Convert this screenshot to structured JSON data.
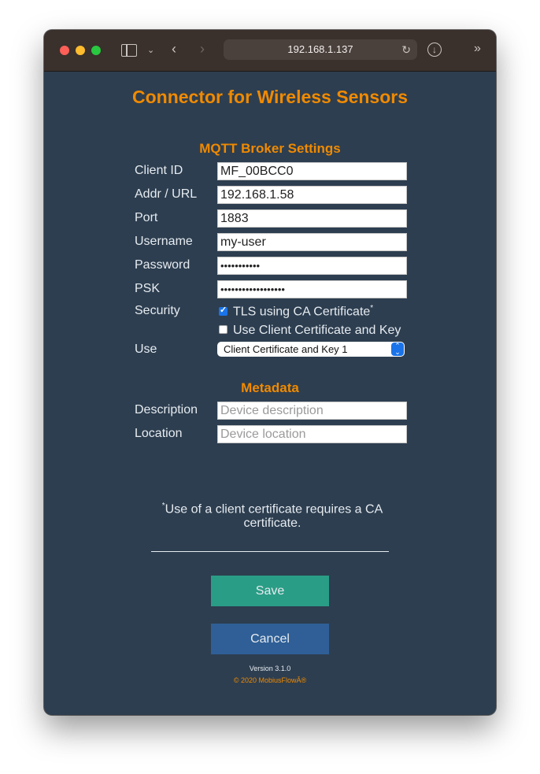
{
  "browser": {
    "url": "192.168.1.137",
    "icons": [
      "sidebar-icon",
      "chevron-down-icon",
      "back-icon",
      "forward-icon",
      "reload-icon",
      "download-icon",
      "overflow-icon"
    ]
  },
  "page": {
    "title": "Connector for Wireless Sensors",
    "mqtt": {
      "heading": "MQTT Broker Settings",
      "client_id_label": "Client ID",
      "client_id_value": "MF_00BCC0",
      "addr_label": "Addr / URL",
      "addr_value": "192.168.1.58",
      "port_label": "Port",
      "port_value": "1883",
      "username_label": "Username",
      "username_value": "my-user",
      "password_label": "Password",
      "password_value": "•••••••••••",
      "psk_label": "PSK",
      "psk_value": "••••••••••••••••••",
      "security_label": "Security",
      "tls_label": "TLS using CA Certificate",
      "tls_checked": true,
      "client_cert_label": "Use Client Certificate and Key",
      "client_cert_checked": false,
      "use_label": "Use",
      "use_selected": "Client Certificate and Key 1"
    },
    "metadata": {
      "heading": "Metadata",
      "description_label": "Description",
      "description_placeholder": "Device description",
      "location_label": "Location",
      "location_placeholder": "Device location"
    },
    "note_star": "*",
    "note": "Use of a client certificate requires a CA certificate.",
    "save_label": "Save",
    "cancel_label": "Cancel",
    "version": "Version 3.1.0",
    "copyright": "© 2020 MobiusFlowÂ®"
  },
  "colors": {
    "background": "#2d3e50",
    "accent": "#f08a00",
    "save": "#2a9d86",
    "cancel": "#2f5f96"
  }
}
